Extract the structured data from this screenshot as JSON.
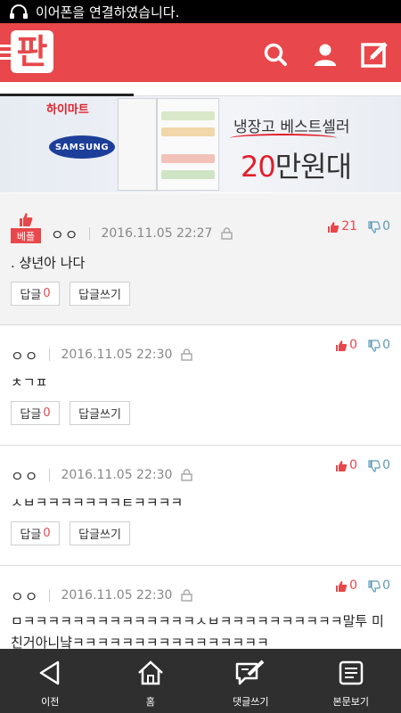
{
  "statusbar": {
    "text": "이어폰을 연결하였습니다.",
    "icon": "headphones-icon"
  },
  "header": {
    "logo_text": "판",
    "icons": [
      "menu-icon",
      "search-icon",
      "user-icon",
      "write-icon"
    ]
  },
  "colors": {
    "brand": "#e8474b",
    "upvote": "#e8474b",
    "downvote": "#5c9bb5",
    "navbar": "#2f2f2f"
  },
  "banner": {
    "store": "하이마트",
    "brand": "SAMSUNG",
    "line1": "냉장고 베스트셀러",
    "line2_red": "20",
    "line2_rest": "만원대"
  },
  "comments": [
    {
      "best_label": "베플",
      "author": "ㅇㅇ",
      "date": "2016.11.05 22:27",
      "up": "21",
      "down": "0",
      "text": ". 샹년아 나다",
      "reply_label": "답글",
      "reply_count": "0",
      "write_label": "답글쓰기"
    },
    {
      "author": "ㅇㅇ",
      "date": "2016.11.05 22:30",
      "up": "0",
      "down": "0",
      "text": "ㅊㄱㅍ",
      "reply_label": "답글",
      "reply_count": "0",
      "write_label": "답글쓰기"
    },
    {
      "author": "ㅇㅇ",
      "date": "2016.11.05 22:30",
      "up": "0",
      "down": "0",
      "text": "ㅅㅂㅋㅋㅋㅋㅋㅋㅋㅌㅋㅋㅋㅋ",
      "reply_label": "답글",
      "reply_count": "0",
      "write_label": "답글쓰기"
    },
    {
      "author": "ㅇㅇ",
      "date": "2016.11.05 22:30",
      "up": "0",
      "down": "0",
      "text": "ㅁㅋㅋㅋㅋㅋㅋㅋㅋㅋㅋㅋㅋㅋㅋㅅㅂㅋㅋㅋㅋㅋㅋㅋㅋㅋㅋ말투 미친거아니냨ㅋㅋㅋㅋㅋㅋㅋㅋㅋㅋㅋㅋㅋㅋㅋㅋ"
    }
  ],
  "navbar": {
    "items": [
      {
        "label": "이전",
        "icon": "back-icon"
      },
      {
        "label": "홈",
        "icon": "home-icon"
      },
      {
        "label": "댓글쓰기",
        "icon": "comment-write-icon"
      },
      {
        "label": "본문보기",
        "icon": "article-icon"
      }
    ]
  }
}
